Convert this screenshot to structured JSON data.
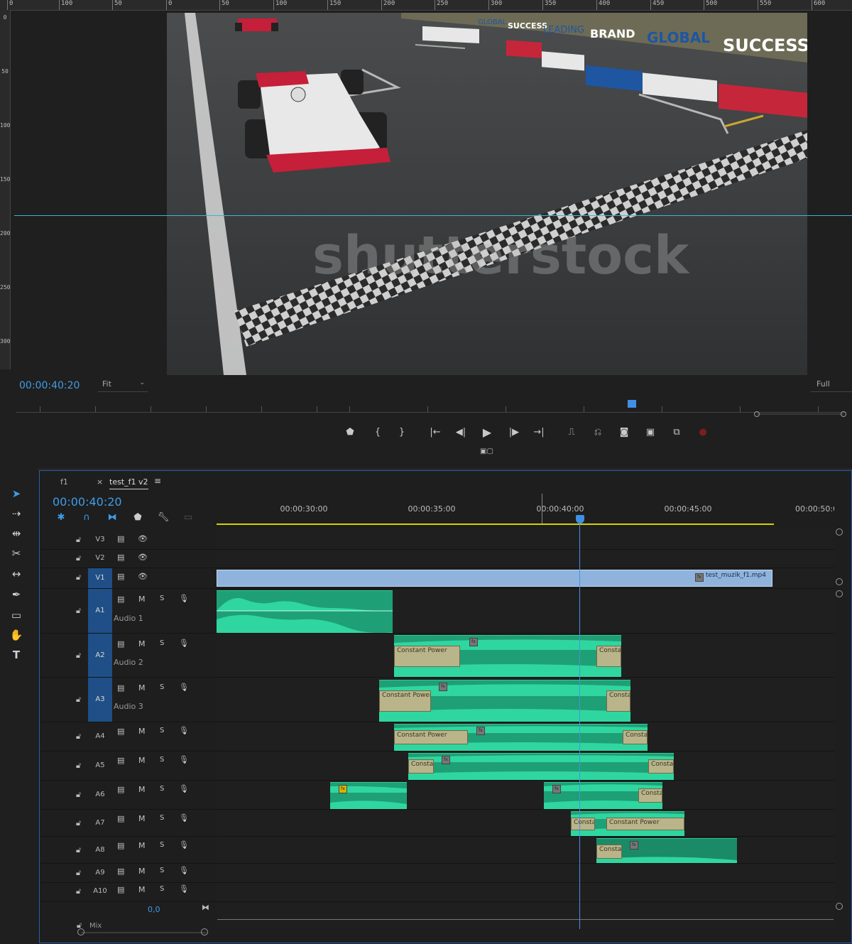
{
  "monitor": {
    "ruler_labels": [
      "0",
      "100",
      "50",
      "0",
      "50",
      "100",
      "150",
      "200",
      "250",
      "300",
      "350",
      "400",
      "450",
      "500",
      "550",
      "600"
    ],
    "vertical_ruler_labels": [
      "0",
      "50",
      "100",
      "150",
      "200",
      "250",
      "300"
    ],
    "watermark": "shutterstock",
    "banner_texts": [
      "GLOBAL",
      "SUCCESS",
      "LEADING",
      "BRAND",
      "GLOBAL",
      "SUCCESS"
    ],
    "timecode": "00:00:40:20",
    "fit_label": "Fit",
    "full_label": "Full",
    "transport_buttons": [
      {
        "name": "add-marker-button",
        "glyph": "⬟"
      },
      {
        "name": "mark-in-button",
        "glyph": "{"
      },
      {
        "name": "mark-out-button",
        "glyph": "}"
      },
      {
        "name": "go-to-in-button",
        "glyph": "|←"
      },
      {
        "name": "step-back-button",
        "glyph": "◀|"
      },
      {
        "name": "play-button",
        "glyph": "▶"
      },
      {
        "name": "step-forward-button",
        "glyph": "|▶"
      },
      {
        "name": "go-to-out-button",
        "glyph": "→|"
      },
      {
        "name": "lift-button",
        "glyph": "⎍"
      },
      {
        "name": "extract-button",
        "glyph": "⎌"
      },
      {
        "name": "export-frame-button",
        "glyph": "◙"
      },
      {
        "name": "comparison-view-button",
        "glyph": "▣"
      },
      {
        "name": "multicam-button",
        "glyph": "⧉"
      },
      {
        "name": "record-button",
        "glyph": "●"
      }
    ],
    "layout_icon": "▣▢"
  },
  "tools": [
    {
      "name": "selection-tool",
      "glyph": "➤"
    },
    {
      "name": "track-select-tool",
      "glyph": "⇢"
    },
    {
      "name": "ripple-edit-tool",
      "glyph": "⇹"
    },
    {
      "name": "razor-tool",
      "glyph": "✂"
    },
    {
      "name": "slip-tool",
      "glyph": "↔"
    },
    {
      "name": "pen-tool",
      "glyph": "✒"
    },
    {
      "name": "rectangle-tool",
      "glyph": "▭"
    },
    {
      "name": "hand-tool",
      "glyph": "✋"
    },
    {
      "name": "type-tool",
      "glyph": "T"
    }
  ],
  "timeline": {
    "tabs": [
      {
        "label": "f1"
      },
      {
        "label": "test_f1 v2",
        "active": true
      }
    ],
    "close_glyph": "×",
    "menu_glyph": "≡",
    "timecode": "00:00:40:20",
    "time_labels": [
      "00:00:30:00",
      "00:00:35:00",
      "00:00:40:00",
      "00:00:45:00",
      "00:00:50:00"
    ],
    "video_tracks": [
      {
        "name": "V3",
        "active": false
      },
      {
        "name": "V2",
        "active": false
      },
      {
        "name": "V1",
        "active": true
      }
    ],
    "audio_tracks": [
      {
        "name": "A1",
        "label": "Audio 1",
        "active": true
      },
      {
        "name": "A2",
        "label": "Audio 2",
        "active": true
      },
      {
        "name": "A3",
        "label": "Audio 3",
        "active": true
      },
      {
        "name": "A4",
        "label": "",
        "active": false
      },
      {
        "name": "A5",
        "label": "",
        "active": false
      },
      {
        "name": "A6",
        "label": "",
        "active": false
      },
      {
        "name": "A7",
        "label": "",
        "active": false
      },
      {
        "name": "A8",
        "label": "",
        "active": false
      },
      {
        "name": "A9",
        "label": "",
        "active": false
      },
      {
        "name": "A10",
        "label": "",
        "active": false
      }
    ],
    "track_buttons": {
      "mute": "M",
      "solo": "S"
    },
    "video_clip_name": "test_muzik_f1.mp4",
    "transitions": {
      "constant_power": "Constant Power",
      "constant_short": "Consta",
      "constant_mid": "Constan",
      "constant_a": "Constar",
      "constant_b": "Constar",
      "constant_c": "Constant Power"
    },
    "fx_badge": "fx",
    "mix_volume": "0,0",
    "mix_label": "Mix",
    "colors": {
      "accent_blue": "#3f9de8",
      "audio_clip": "#1f9f75",
      "video_clip": "#8fb3dd",
      "work_area": "#d6d000",
      "playhead": "#3f8fe6"
    }
  }
}
